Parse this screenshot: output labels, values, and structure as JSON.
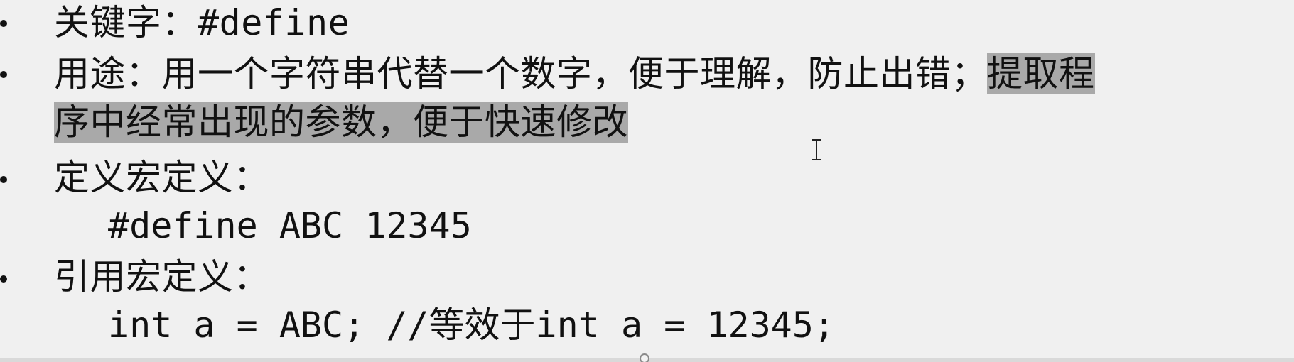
{
  "slide": {
    "items": [
      {
        "label": "关键字：",
        "code": "#define"
      },
      {
        "prefix": "用途：用一个字符串代替一个数字，便于理解，防止出错；",
        "highlight_a": "提取程",
        "highlight_b": "序中经常出现的参数，便于快速修改"
      },
      {
        "label": "定义宏定义：",
        "code_line": "#define ABC 12345"
      },
      {
        "label": "引用宏定义：",
        "code_line_a": "int a = ABC;  //",
        "code_line_cn": "等效于",
        "code_line_b": "int a = 12345;"
      }
    ]
  },
  "icons": {
    "cursor": "text-cursor-icon",
    "scroll": "scroll-handle-icon"
  }
}
